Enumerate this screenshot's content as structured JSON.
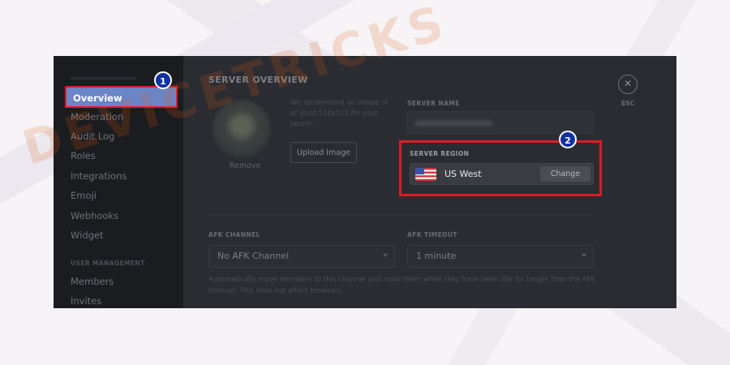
{
  "sidebar": {
    "items": [
      {
        "label": "Overview",
        "active": true
      },
      {
        "label": "Moderation"
      },
      {
        "label": "Audit Log"
      },
      {
        "label": "Roles"
      },
      {
        "label": "Integrations"
      },
      {
        "label": "Emoji"
      },
      {
        "label": "Webhooks"
      },
      {
        "label": "Widget"
      }
    ],
    "section_label": "USER MANAGEMENT",
    "section_items": [
      {
        "label": "Members"
      },
      {
        "label": "Invites"
      }
    ]
  },
  "main": {
    "title": "SERVER OVERVIEW",
    "avatar_remove": "Remove",
    "icon_hint": "We recommend an image of at least 512x512 for your server.",
    "upload_button": "Upload Image",
    "server_name_label": "SERVER NAME",
    "region": {
      "label": "SERVER REGION",
      "value": "US West",
      "change_button": "Change",
      "flag_icon": "us-flag-icon"
    },
    "afk_channel_label": "AFK CHANNEL",
    "afk_channel_value": "No AFK Channel",
    "afk_timeout_label": "AFK TIMEOUT",
    "afk_timeout_value": "1 minute",
    "afk_note": "Automatically move members to this channel and mute them when they have been idle for longer than the AFK timeout. This does not affect browsers.",
    "close_icon": "✕",
    "close_label": "ESC"
  },
  "annotations": {
    "step1": "1",
    "step2": "2"
  },
  "watermark": "DEVICETRICKS",
  "colors": {
    "active_item": "#6b85c6",
    "highlight_border": "#e01b24",
    "badge": "#1231a1"
  }
}
